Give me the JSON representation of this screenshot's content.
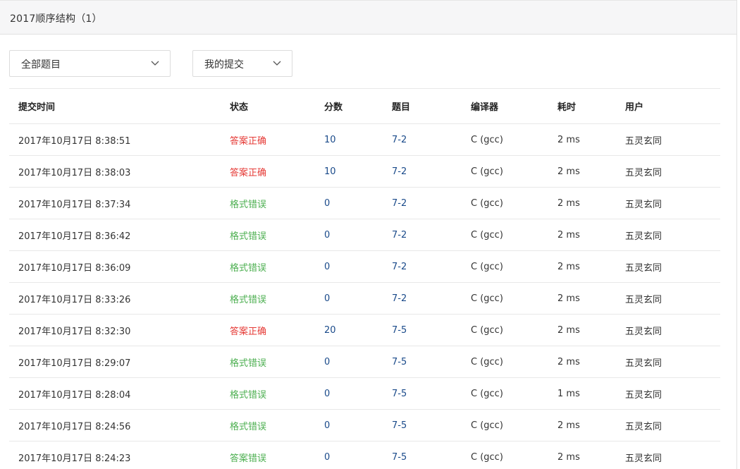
{
  "header": {
    "title": "2017顺序结构（1）"
  },
  "filters": {
    "problem_select": "全部题目",
    "submission_select": "我的提交"
  },
  "table": {
    "columns": [
      "提交时间",
      "状态",
      "分数",
      "题目",
      "编译器",
      "耗时",
      "用户"
    ],
    "rows": [
      {
        "time": "2017年10月17日 8:38:51",
        "status": "答案正确",
        "status_color": "red",
        "score": "10",
        "problem": "7-2",
        "compiler": "C (gcc)",
        "elapsed": "2 ms",
        "user": "五灵玄同"
      },
      {
        "time": "2017年10月17日 8:38:03",
        "status": "答案正确",
        "status_color": "red",
        "score": "10",
        "problem": "7-2",
        "compiler": "C (gcc)",
        "elapsed": "2 ms",
        "user": "五灵玄同"
      },
      {
        "time": "2017年10月17日 8:37:34",
        "status": "格式错误",
        "status_color": "green",
        "score": "0",
        "problem": "7-2",
        "compiler": "C (gcc)",
        "elapsed": "2 ms",
        "user": "五灵玄同"
      },
      {
        "time": "2017年10月17日 8:36:42",
        "status": "格式错误",
        "status_color": "green",
        "score": "0",
        "problem": "7-2",
        "compiler": "C (gcc)",
        "elapsed": "2 ms",
        "user": "五灵玄同"
      },
      {
        "time": "2017年10月17日 8:36:09",
        "status": "格式错误",
        "status_color": "green",
        "score": "0",
        "problem": "7-2",
        "compiler": "C (gcc)",
        "elapsed": "2 ms",
        "user": "五灵玄同"
      },
      {
        "time": "2017年10月17日 8:33:26",
        "status": "格式错误",
        "status_color": "green",
        "score": "0",
        "problem": "7-2",
        "compiler": "C (gcc)",
        "elapsed": "2 ms",
        "user": "五灵玄同"
      },
      {
        "time": "2017年10月17日 8:32:30",
        "status": "答案正确",
        "status_color": "red",
        "score": "20",
        "problem": "7-5",
        "compiler": "C (gcc)",
        "elapsed": "2 ms",
        "user": "五灵玄同"
      },
      {
        "time": "2017年10月17日 8:29:07",
        "status": "格式错误",
        "status_color": "green",
        "score": "0",
        "problem": "7-5",
        "compiler": "C (gcc)",
        "elapsed": "2 ms",
        "user": "五灵玄同"
      },
      {
        "time": "2017年10月17日 8:28:04",
        "status": "格式错误",
        "status_color": "green",
        "score": "0",
        "problem": "7-5",
        "compiler": "C (gcc)",
        "elapsed": "1 ms",
        "user": "五灵玄同"
      },
      {
        "time": "2017年10月17日 8:24:56",
        "status": "格式错误",
        "status_color": "green",
        "score": "0",
        "problem": "7-5",
        "compiler": "C (gcc)",
        "elapsed": "2 ms",
        "user": "五灵玄同"
      },
      {
        "time": "2017年10月17日 8:24:23",
        "status": "答案错误",
        "status_color": "green",
        "score": "0",
        "problem": "7-5",
        "compiler": "C (gcc)",
        "elapsed": "2 ms",
        "user": "五灵玄同"
      }
    ]
  },
  "colors": {
    "status_red": "#e53935",
    "status_green": "#4caf50",
    "link_blue": "#1a4a8a",
    "header_bg": "#f6f6f7"
  }
}
